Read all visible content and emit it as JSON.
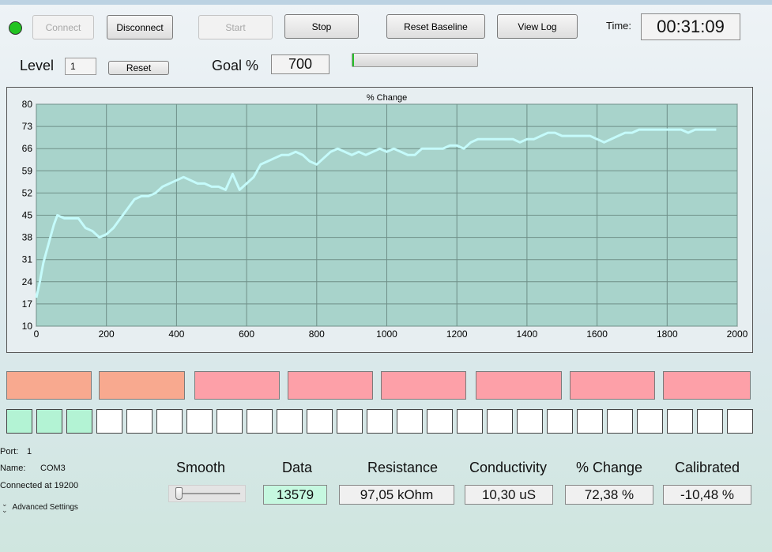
{
  "toolbar": {
    "connect": "Connect",
    "disconnect": "Disconnect",
    "start": "Start",
    "stop": "Stop",
    "reset_baseline": "Reset Baseline",
    "view_log": "View Log",
    "time_label": "Time:",
    "time_value": "00:31:09",
    "status_color": "#22c322"
  },
  "level": {
    "label": "Level",
    "value": "1",
    "reset": "Reset"
  },
  "goal": {
    "label": "Goal %",
    "value": "700",
    "progress": 0.01
  },
  "chart_data": {
    "type": "line",
    "title": "% Change",
    "xlim": [
      0,
      2000
    ],
    "ylim": [
      10,
      80
    ],
    "xticks": [
      0,
      200,
      400,
      600,
      800,
      1000,
      1200,
      1400,
      1600,
      1800,
      2000
    ],
    "yticks": [
      10,
      17,
      24,
      31,
      38,
      45,
      52,
      59,
      66,
      73,
      80
    ],
    "grid": true,
    "line_color": "#c5fbfb",
    "plot_bg": "#a8d3cb",
    "series": [
      {
        "x": [
          0,
          10,
          20,
          30,
          40,
          50,
          60,
          80,
          100,
          120,
          140,
          160,
          180,
          200,
          220,
          240,
          260,
          280,
          300,
          320,
          340,
          360,
          380,
          400,
          420,
          440,
          460,
          480,
          500,
          520,
          540,
          560,
          580,
          600,
          620,
          640,
          660,
          680,
          700,
          720,
          740,
          760,
          780,
          800,
          820,
          840,
          860,
          880,
          900,
          920,
          940,
          960,
          980,
          1000,
          1020,
          1040,
          1060,
          1080,
          1100,
          1120,
          1140,
          1160,
          1180,
          1200,
          1220,
          1240,
          1260,
          1280,
          1300,
          1320,
          1340,
          1360,
          1380,
          1400,
          1420,
          1440,
          1460,
          1480,
          1500,
          1520,
          1540,
          1560,
          1580,
          1600,
          1620,
          1640,
          1660,
          1680,
          1700,
          1720,
          1740,
          1760,
          1780,
          1800,
          1820,
          1840,
          1860,
          1880,
          1900,
          1920,
          1940
        ],
        "y": [
          19,
          24,
          30,
          34,
          38,
          42,
          45,
          44,
          44,
          44,
          41,
          40,
          38,
          39,
          41,
          44,
          47,
          50,
          51,
          51,
          52,
          54,
          55,
          56,
          57,
          56,
          55,
          55,
          54,
          54,
          53,
          58,
          53,
          55,
          57,
          61,
          62,
          63,
          64,
          64,
          65,
          64,
          62,
          61,
          63,
          65,
          66,
          65,
          64,
          65,
          64,
          65,
          66,
          65,
          66,
          65,
          64,
          64,
          66,
          66,
          66,
          66,
          67,
          67,
          66,
          68,
          69,
          69,
          69,
          69,
          69,
          69,
          68,
          69,
          69,
          70,
          71,
          71,
          70,
          70,
          70,
          70,
          70,
          69,
          68,
          69,
          70,
          71,
          71,
          72,
          72,
          72,
          72,
          72,
          72,
          72,
          71,
          72,
          72,
          72,
          72
        ]
      }
    ]
  },
  "zones": [
    {
      "color": "#f8a98f"
    },
    {
      "color": "#f8a98f"
    },
    {
      "color": "#fda0a8"
    },
    {
      "color": "#fda0a8"
    },
    {
      "color": "#fda0a8"
    },
    {
      "color": "#fda0a8"
    },
    {
      "color": "#fda0a8"
    },
    {
      "color": "#fda0a8"
    }
  ],
  "level_cells": {
    "total": 25,
    "filled": 3,
    "fill_color": "#b3f3d4"
  },
  "port": {
    "port_label": "Port:",
    "port_value": "1",
    "name_label": "Name:",
    "name_value": "COM3",
    "connected": "Connected at 19200",
    "advanced": "Advanced Settings"
  },
  "metrics": {
    "smooth_label": "Smooth",
    "data_label": "Data",
    "data_value": "13579",
    "data_bg": "#c6f8e0",
    "resistance_label": "Resistance",
    "resistance_value": "97,05 kOhm",
    "conductivity_label": "Conductivity",
    "conductivity_value": "10,30 uS",
    "change_label": "% Change",
    "change_value": "72,38 %",
    "calibrated_label": "Calibrated",
    "calibrated_value": "-10,48 %"
  }
}
